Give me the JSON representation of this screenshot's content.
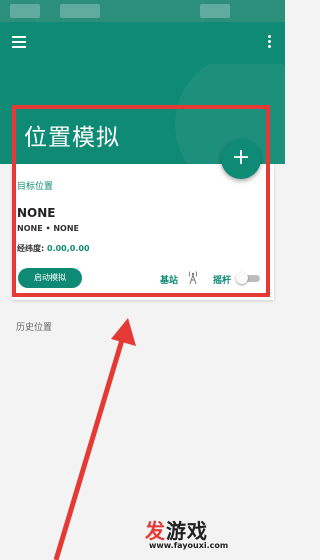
{
  "app_bar": {
    "menu_icon": "menu-icon",
    "more_icon": "more-vert-icon",
    "color": "#0f8a74"
  },
  "page": {
    "title": "位置模拟",
    "fab_label": "+"
  },
  "card": {
    "target_label": "目标位置",
    "location_name": "NONE",
    "location_sub": "NONE • NONE",
    "coord_label": "经纬度:",
    "coord_value": "0.00,0.00",
    "start_button": "启动模拟",
    "base_station_label": "基站",
    "base_station_icon": "cell-tower-icon",
    "joystick_label": "摇杆",
    "joystick_enabled": false
  },
  "history": {
    "label": "历史位置"
  },
  "annotation": {
    "color": "#e53935"
  },
  "watermark": {
    "title_red": "发",
    "title_dark": "游戏",
    "url": "www.fayouxi.com"
  }
}
